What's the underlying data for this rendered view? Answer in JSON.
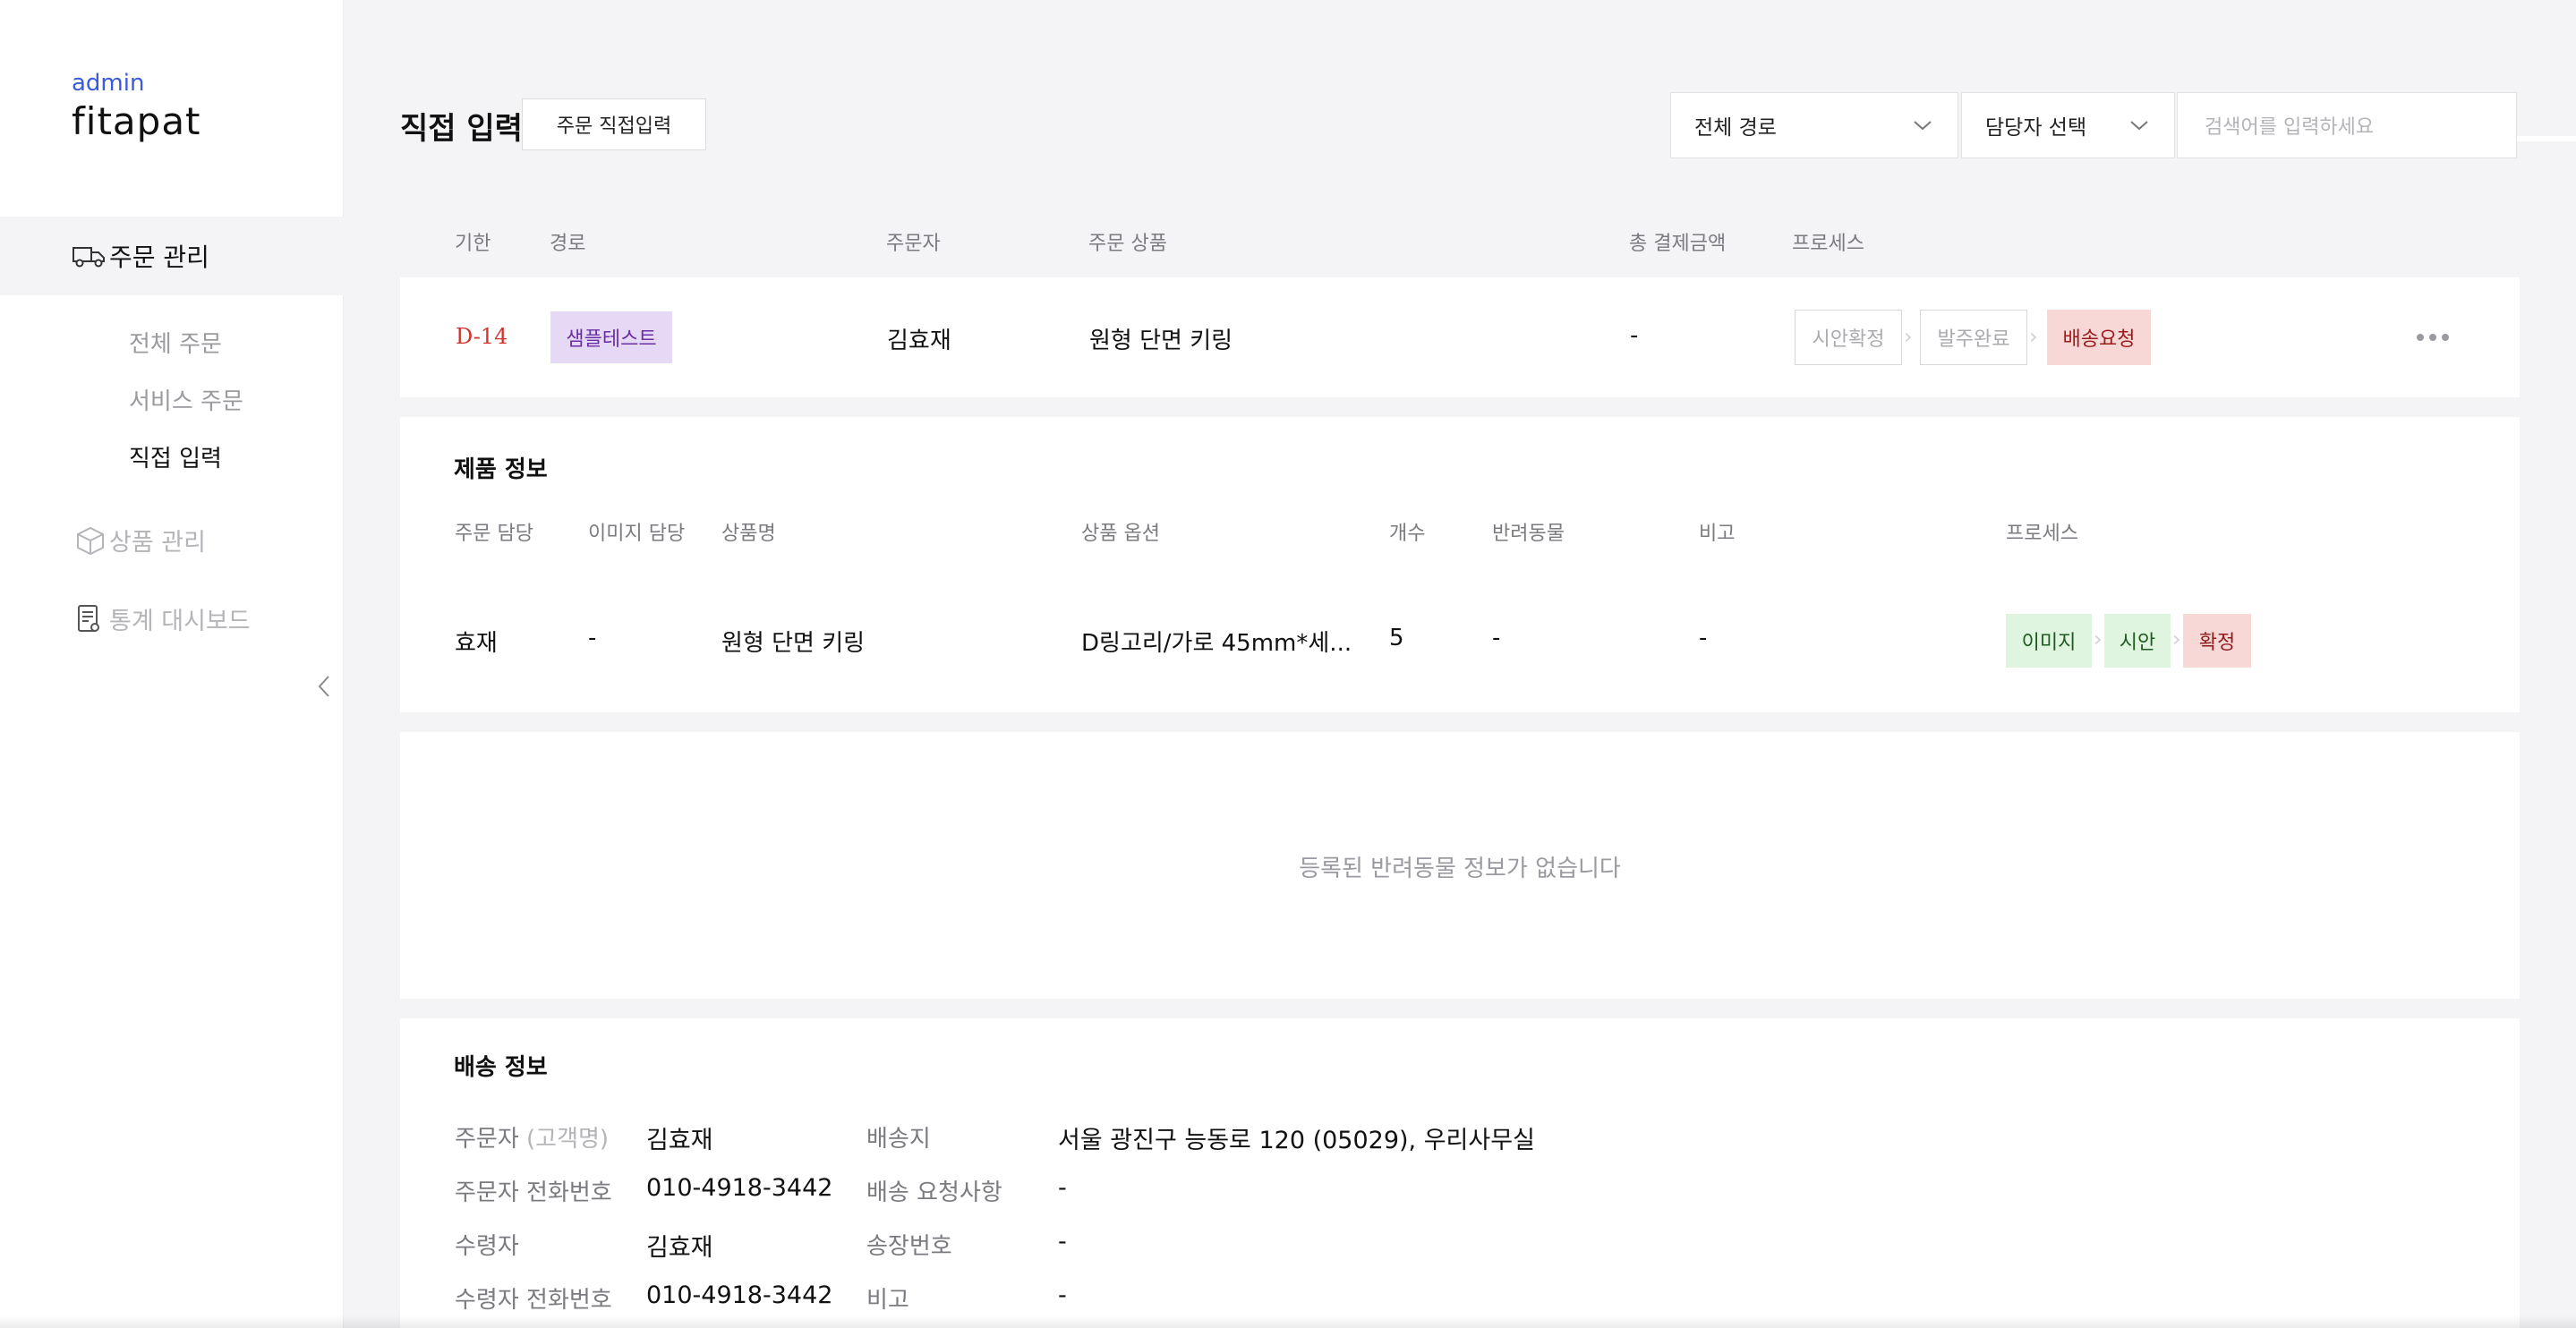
{
  "brand": {
    "role": "admin",
    "name": "fitapat"
  },
  "sidebar": {
    "order_mgmt": "주문 관리",
    "sub_items": [
      "전체 주문",
      "서비스 주문",
      "직접 입력"
    ],
    "product_mgmt": "상품 관리",
    "stats_dashboard": "통계 대시보드"
  },
  "header": {
    "title": "직접 입력",
    "direct_order_button": "주문 직접입력",
    "route_select": "전체 경로",
    "manager_select": "담당자 선택",
    "search_placeholder": "검색어를 입력하세요"
  },
  "order_table": {
    "columns": [
      "기한",
      "경로",
      "주문자",
      "주문 상품",
      "총 결제금액",
      "프로세스"
    ],
    "row": {
      "deadline": "D-14",
      "route": "샘플테스트",
      "orderer": "김효재",
      "product": "원형 단면 키링",
      "total": "-",
      "steps": [
        "시안확정",
        "발주완료",
        "배송요청"
      ]
    }
  },
  "product_info": {
    "title": "제품 정보",
    "columns": [
      "주문 담당",
      "이미지 담당",
      "상품명",
      "상품 옵션",
      "개수",
      "반려동물",
      "비고",
      "프로세스"
    ],
    "row": {
      "order_manager": "효재",
      "image_manager": "-",
      "name": "원형 단면 키링",
      "option": "D링고리/가로 45mm*세...",
      "count": "5",
      "pet": "-",
      "note": "-",
      "steps": [
        "이미지",
        "시안",
        "확정"
      ]
    }
  },
  "pet_info": {
    "empty_message": "등록된 반려동물 정보가 없습니다"
  },
  "shipping": {
    "title": "배송 정보",
    "orderer_label": "주문자",
    "orderer_label_suffix": "(고객명)",
    "orderer": "김효재",
    "orderer_phone_label": "주문자 전화번호",
    "orderer_phone": "010-4918-3442",
    "receiver_label": "수령자",
    "receiver": "김효재",
    "receiver_phone_label": "수령자 전화번호",
    "receiver_phone": "010-4918-3442",
    "address_label": "배송지",
    "address": "서울 광진구 능동로 120 (05029), 우리사무실",
    "request_label": "배송 요청사항",
    "request": "-",
    "invoice_label": "송장번호",
    "invoice": "-",
    "note_label": "비고",
    "note": "-"
  }
}
